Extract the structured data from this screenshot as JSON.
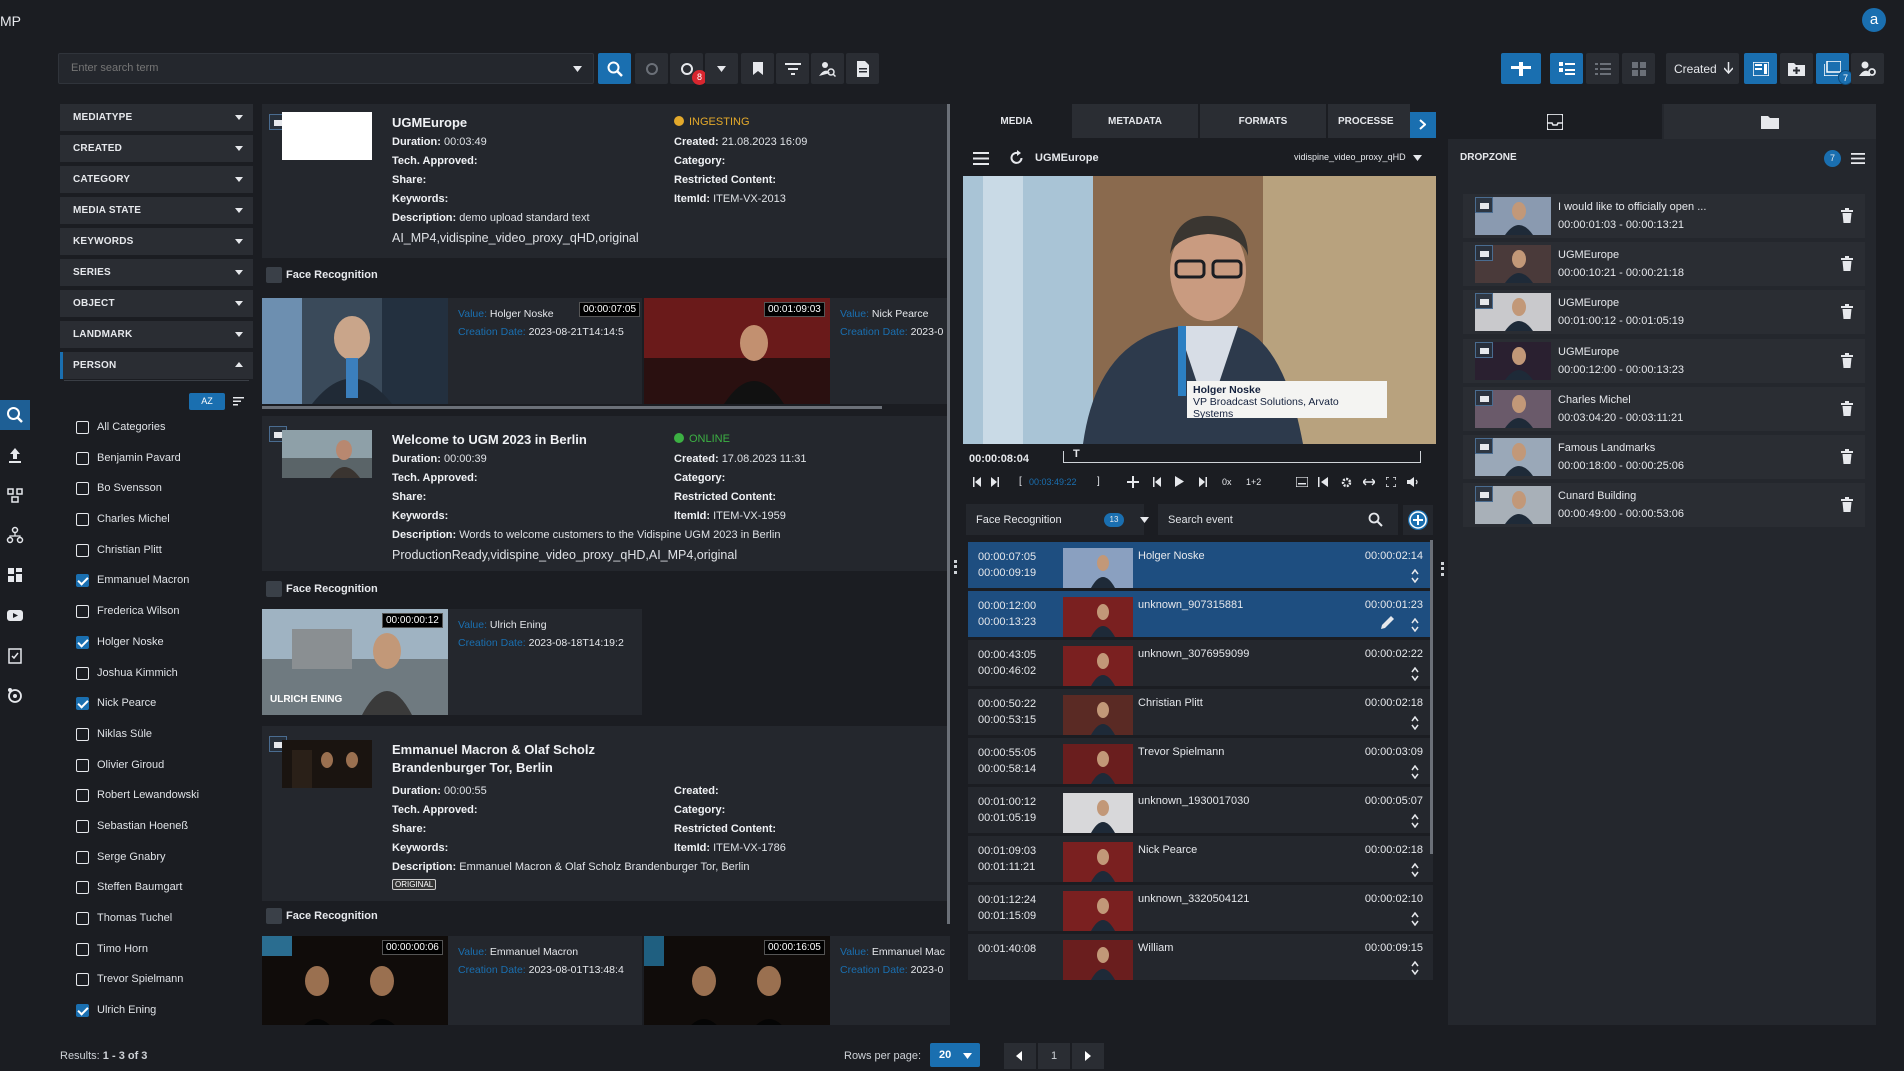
{
  "app": {
    "logo_text": "MP",
    "avatar_letter": "a"
  },
  "toolbar": {
    "search_placeholder": "Enter search term",
    "sync_badge": "8",
    "sort_label": "Created",
    "collections_badge": "7"
  },
  "facets": [
    {
      "label": "MEDIATYPE"
    },
    {
      "label": "CREATED"
    },
    {
      "label": "CATEGORY"
    },
    {
      "label": "MEDIA STATE"
    },
    {
      "label": "KEYWORDS"
    },
    {
      "label": "SERIES"
    },
    {
      "label": "OBJECT"
    },
    {
      "label": "LANDMARK"
    },
    {
      "label": "PERSON"
    }
  ],
  "person_sort_label": "AZ",
  "persons": [
    {
      "label": "All Categories",
      "checked": false
    },
    {
      "label": "Benjamin Pavard",
      "checked": false
    },
    {
      "label": "Bo Svensson",
      "checked": false
    },
    {
      "label": "Charles Michel",
      "checked": false
    },
    {
      "label": "Christian Plitt",
      "checked": false
    },
    {
      "label": "Emmanuel Macron",
      "checked": true
    },
    {
      "label": "Frederica Wilson",
      "checked": false
    },
    {
      "label": "Holger Noske",
      "checked": true
    },
    {
      "label": "Joshua Kimmich",
      "checked": false
    },
    {
      "label": "Nick Pearce",
      "checked": true
    },
    {
      "label": "Niklas Süle",
      "checked": false
    },
    {
      "label": "Olivier Giroud",
      "checked": false
    },
    {
      "label": "Robert Lewandowski",
      "checked": false
    },
    {
      "label": "Sebastian Hoeneß",
      "checked": false
    },
    {
      "label": "Serge Gnabry",
      "checked": false
    },
    {
      "label": "Steffen Baumgart",
      "checked": false
    },
    {
      "label": "Thomas Tuchel",
      "checked": false
    },
    {
      "label": "Timo Horn",
      "checked": false
    },
    {
      "label": "Trevor Spielmann",
      "checked": false
    },
    {
      "label": "Ulrich Ening",
      "checked": true
    }
  ],
  "footer": {
    "results": "Results: ",
    "results_range": "1 - 3 of 3",
    "rows_per_page_label": "Rows per page:",
    "rows_per_page": "20",
    "page": "1"
  },
  "labels": {
    "duration": "Duration:",
    "tech_approved": "Tech. Approved:",
    "share": "Share:",
    "keywords": "Keywords:",
    "description": "Description:",
    "created": "Created:",
    "category": "Category:",
    "restricted": "Restricted Content:",
    "itemid": "ItemId:",
    "face_recognition": "Face Recognition",
    "value": "Value:",
    "creation_date": "Creation Date:"
  },
  "results": [
    {
      "title": "UGMEurope",
      "status": "INGESTING",
      "status_color": "#e3a92b",
      "duration": "00:03:49",
      "created": "21.08.2023 16:09",
      "itemid": "ITEM-VX-2013",
      "description": "demo upload standard text",
      "formats": "AI_MP4,vidispine_video_proxy_qHD,original",
      "faces": [
        {
          "tc": "00:00:07:05",
          "value": "Holger Noske",
          "date": "2023-08-21T14:14:5"
        },
        {
          "tc": "00:01:09:03",
          "value": "Nick Pearce",
          "date": "2023-0"
        }
      ]
    },
    {
      "title": "Welcome to UGM 2023 in Berlin",
      "status": "ONLINE",
      "status_color": "#3cb043",
      "duration": "00:00:39",
      "created": "17.08.2023 11:31",
      "itemid": "ITEM-VX-1959",
      "description": "Words to welcome customers to the Vidispine UGM 2023 in Berlin",
      "formats": "ProductionReady,vidispine_video_proxy_qHD,AI_MP4,original",
      "faces": [
        {
          "tc": "00:00:00:12",
          "value": "Ulrich Ening",
          "date": "2023-08-18T14:19:2",
          "overlay": "ULRICH ENING"
        }
      ]
    },
    {
      "title": "Emmanuel Macron & Olaf Scholz",
      "title2": "Brandenburger Tor, Berlin",
      "duration": "00:00:55",
      "created": "",
      "itemid": "ITEM-VX-1786",
      "description": "Emmanuel Macron & Olaf Scholz Brandenburger Tor, Berlin",
      "tag": "ORIGINAL",
      "faces": [
        {
          "tc": "00:00:00:06",
          "value": "Emmanuel Macron",
          "date": "2023-08-01T13:48:4"
        },
        {
          "tc": "00:00:16:05",
          "value": "Emmanuel Mac",
          "date": "2023-0"
        }
      ]
    }
  ],
  "player": {
    "tabs": [
      "MEDIA",
      "METADATA",
      "FORMATS",
      "PROCESSE"
    ],
    "title": "UGMEurope",
    "format": "vidispine_video_proxy_qHD",
    "current_tc": "00:00:08:04",
    "out_tc": "00:03:49:22",
    "lowerthird_name": "Holger Noske",
    "lowerthird_role": "VP Broadcast Solutions, Arvato Systems",
    "speed": "0x",
    "step": "1+2",
    "event_filter": "Face Recognition",
    "event_count": "13",
    "event_search_placeholder": "Search event"
  },
  "events": [
    {
      "in": "00:00:07:05",
      "out": "00:00:09:19",
      "name": "Holger Noske",
      "dur": "00:00:02:14",
      "selected": true
    },
    {
      "in": "00:00:12:00",
      "out": "00:00:13:23",
      "name": "unknown_907315881",
      "dur": "00:00:01:23",
      "selected": true
    },
    {
      "in": "00:00:43:05",
      "out": "00:00:46:02",
      "name": "unknown_3076959099",
      "dur": "00:00:02:22"
    },
    {
      "in": "00:00:50:22",
      "out": "00:00:53:15",
      "name": "Christian Plitt",
      "dur": "00:00:02:18"
    },
    {
      "in": "00:00:55:05",
      "out": "00:00:58:14",
      "name": "Trevor Spielmann",
      "dur": "00:00:03:09"
    },
    {
      "in": "00:01:00:12",
      "out": "00:01:05:19",
      "name": "unknown_1930017030",
      "dur": "00:00:05:07"
    },
    {
      "in": "00:01:09:03",
      "out": "00:01:11:21",
      "name": "Nick Pearce",
      "dur": "00:00:02:18"
    },
    {
      "in": "00:01:12:24",
      "out": "00:01:15:09",
      "name": "unknown_3320504121",
      "dur": "00:00:02:10"
    },
    {
      "in": "00:01:40:08",
      "out": "",
      "name": "William",
      "dur": "00:00:09:15"
    }
  ],
  "dropzone": {
    "title": "DROPZONE",
    "count": "7",
    "items": [
      {
        "name": "I would like to officially open ...",
        "in": "00:00:01:03",
        "out": "00:00:13:21"
      },
      {
        "name": "UGMEurope",
        "in": "00:00:10:21",
        "out": "00:00:21:18"
      },
      {
        "name": "UGMEurope",
        "in": "00:01:00:12",
        "out": "00:01:05:19"
      },
      {
        "name": "UGMEurope",
        "in": "00:00:12:00",
        "out": "00:00:13:23"
      },
      {
        "name": "Charles Michel",
        "in": "00:03:04:20",
        "out": "00:03:11:21"
      },
      {
        "name": "Famous Landmarks",
        "in": "00:00:18:00",
        "out": "00:00:25:06"
      },
      {
        "name": "Cunard Building",
        "in": "00:00:49:00",
        "out": "00:00:53:06"
      }
    ]
  },
  "colors": {
    "accent": "#1a6fb0",
    "panel": "#24272d",
    "bg": "#1b1d22"
  }
}
